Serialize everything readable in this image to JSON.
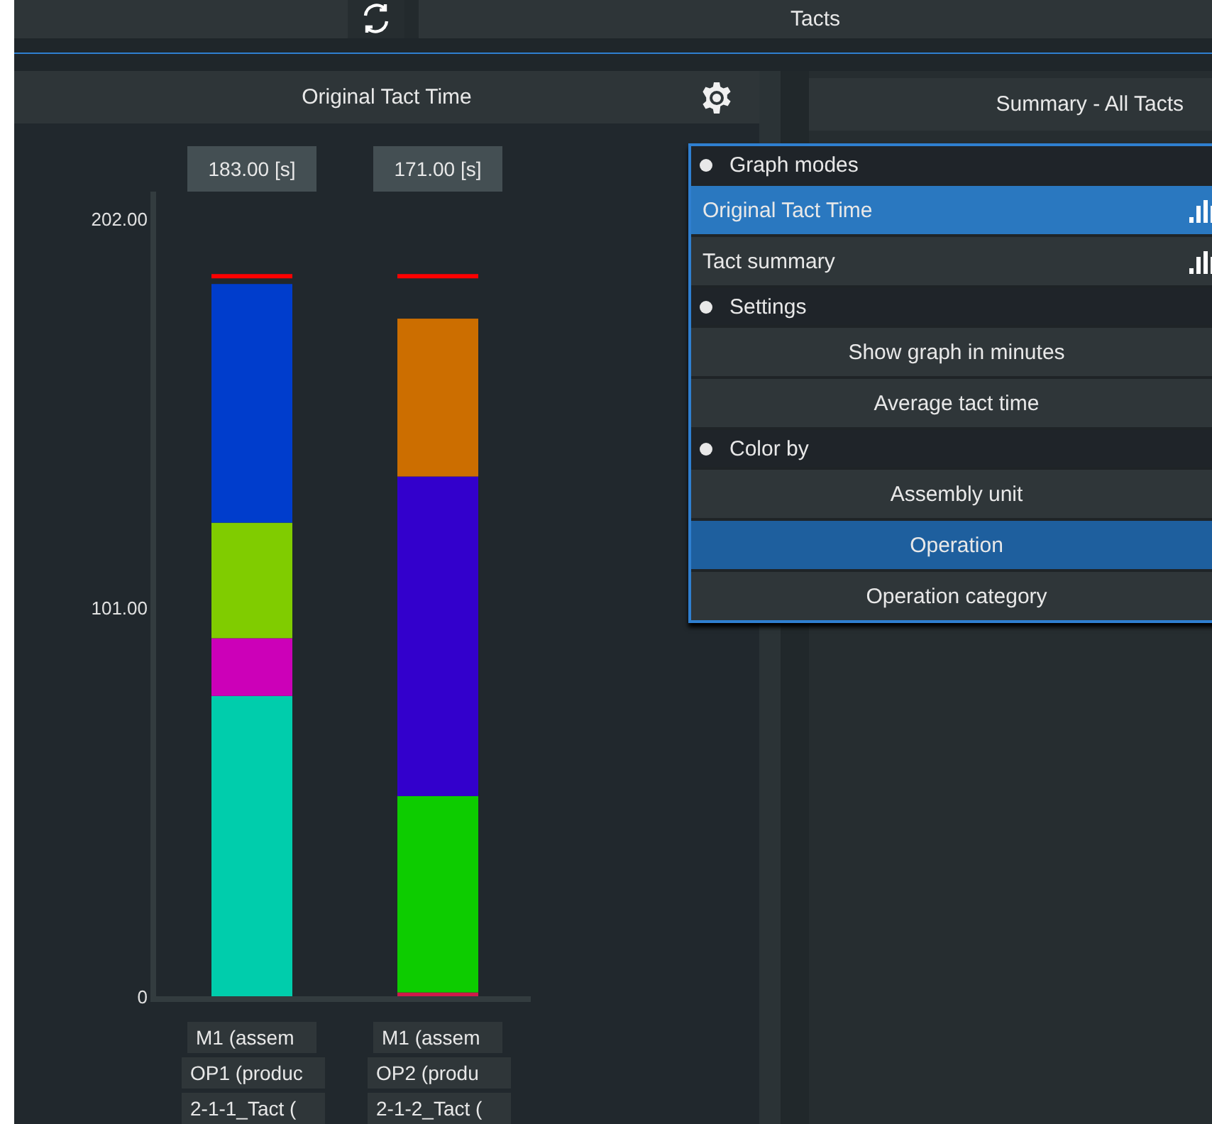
{
  "toolbar": {
    "tabs": [
      {
        "label": "Tacts",
        "selected": true
      }
    ]
  },
  "left_panel": {
    "title": "Original Tact Time",
    "totals": [
      "183.00 [s]",
      "171.00 [s]"
    ],
    "chart_data": {
      "type": "bar",
      "stacked": true,
      "categories": [
        "M1 (assem",
        "M1 (assem"
      ],
      "ylim": [
        0,
        209
      ],
      "yticks": [
        {
          "value": 0,
          "label": "0"
        },
        {
          "value": 101,
          "label": "101.00"
        },
        {
          "value": 202,
          "label": "202.00"
        }
      ],
      "series": [
        {
          "color": "#00cdac",
          "values": [
            78,
            null
          ]
        },
        {
          "color": "#cc00b8",
          "values": [
            15,
            null
          ]
        },
        {
          "color": "#80cc00",
          "values": [
            30,
            null
          ]
        },
        {
          "color": "#003dcc",
          "values": [
            62,
            null
          ]
        },
        {
          "color": "#d0194a",
          "values": [
            null,
            1
          ]
        },
        {
          "color": "#0dcc00",
          "values": [
            null,
            51
          ]
        },
        {
          "color": "#3300cc",
          "values": [
            null,
            83
          ]
        },
        {
          "color": "#cc6e00",
          "values": [
            null,
            41
          ]
        }
      ],
      "ref_lines": [
        {
          "axis": "y",
          "value": 187,
          "color": "#ff0000"
        }
      ]
    },
    "category_details": [
      {
        "lines": [
          "OP1 (produc",
          "2-1-1_Tact ("
        ]
      },
      {
        "lines": [
          "OP2 (produ",
          "2-1-2_Tact ("
        ]
      }
    ]
  },
  "right_panel": {
    "title": "Summary - All Tacts"
  },
  "menu": {
    "sections": [
      {
        "title": "Graph modes",
        "items": [
          {
            "label": "Original Tact Time",
            "kind": "mode",
            "selected": true
          },
          {
            "label": "Tact summary",
            "kind": "mode",
            "selected": false
          }
        ]
      },
      {
        "title": "Settings",
        "items": [
          {
            "label": "Show graph in minutes",
            "kind": "button",
            "selected": false
          },
          {
            "label": "Average tact time",
            "kind": "button",
            "selected": false
          }
        ]
      },
      {
        "title": "Color by",
        "items": [
          {
            "label": "Assembly unit",
            "kind": "button",
            "selected": false
          },
          {
            "label": "Operation",
            "kind": "button",
            "selected": true
          },
          {
            "label": "Operation category",
            "kind": "button",
            "selected": false
          }
        ]
      }
    ]
  }
}
